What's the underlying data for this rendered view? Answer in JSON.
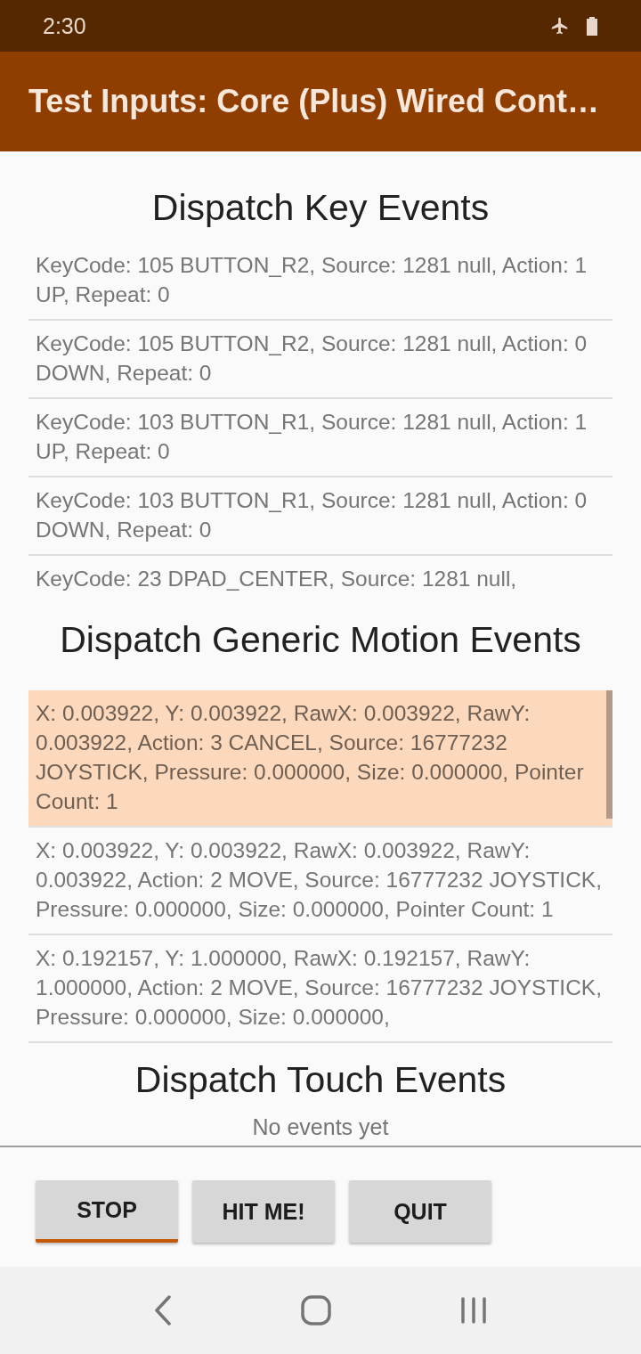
{
  "status_bar": {
    "time": "2:30"
  },
  "app_bar": {
    "title": "Test Inputs: Core (Plus) Wired Cont…"
  },
  "sections": [
    {
      "title": "Dispatch Key Events",
      "events": [
        {
          "text": "KeyCode: 105 BUTTON_R2, Source: 1281 null, Action: 1 UP, Repeat: 0",
          "selected": false
        },
        {
          "text": "KeyCode: 105 BUTTON_R2, Source: 1281 null, Action: 0 DOWN, Repeat: 0",
          "selected": false
        },
        {
          "text": "KeyCode: 103 BUTTON_R1, Source: 1281 null, Action: 1 UP, Repeat: 0",
          "selected": false
        },
        {
          "text": "KeyCode: 103 BUTTON_R1, Source: 1281 null, Action: 0 DOWN, Repeat: 0",
          "selected": false
        },
        {
          "text": "KeyCode: 23 DPAD_CENTER, Source: 1281 null,",
          "selected": false
        }
      ]
    },
    {
      "title": "Dispatch Generic Motion Events",
      "events": [
        {
          "text": "X: 0.003922, Y: 0.003922, RawX: 0.003922, RawY: 0.003922, Action: 3 CANCEL, Source: 16777232 JOYSTICK, Pressure: 0.000000, Size: 0.000000, Pointer Count: 1",
          "selected": true
        },
        {
          "text": "X: 0.003922, Y: 0.003922, RawX: 0.003922, RawY: 0.003922, Action: 2 MOVE, Source: 16777232 JOYSTICK, Pressure: 0.000000, Size: 0.000000, Pointer Count: 1",
          "selected": false
        },
        {
          "text": "X: 0.192157, Y: 1.000000, RawX: 0.192157, RawY: 1.000000, Action: 2 MOVE, Source: 16777232 JOYSTICK, Pressure: 0.000000, Size: 0.000000,",
          "selected": false
        }
      ]
    },
    {
      "title": "Dispatch Touch Events",
      "empty_text": "No events yet"
    }
  ],
  "buttons": [
    {
      "label": "STOP",
      "selected": true
    },
    {
      "label": "HIT ME!",
      "selected": false
    },
    {
      "label": "QUIT",
      "selected": false
    }
  ]
}
